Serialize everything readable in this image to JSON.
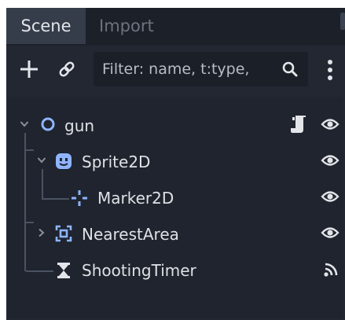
{
  "tabs": [
    {
      "label": "Scene",
      "active": true
    },
    {
      "label": "Import",
      "active": false
    }
  ],
  "toolbar": {
    "add_icon": "plus-icon",
    "link_icon": "link-icon",
    "filter_placeholder": "Filter: name, t:type,",
    "search_icon": "magnifier-icon",
    "menu_icon": "kebab-menu-icon"
  },
  "tree": {
    "nodes": [
      {
        "name": "gun",
        "type": "Node2D",
        "icon": "circle-node-icon",
        "expanded": true,
        "has_script": true,
        "visible": true
      },
      {
        "name": "Sprite2D",
        "type": "Sprite2D",
        "icon": "sprite-face-icon",
        "expanded": true,
        "visible": true
      },
      {
        "name": "Marker2D",
        "type": "Marker2D",
        "icon": "crosshair-marker-icon",
        "visible": true
      },
      {
        "name": "NearestArea",
        "type": "Area2D",
        "icon": "area-frame-icon",
        "expanded": false,
        "visible": true
      },
      {
        "name": "ShootingTimer",
        "type": "Timer",
        "icon": "hourglass-icon",
        "signal": true
      }
    ]
  },
  "colors": {
    "panel_bg": "#222732",
    "tab_active_bg": "#363d4a",
    "tree_bg": "#1f242e",
    "node2d_blue": "#8fb4ff",
    "text": "#dfe1e6"
  }
}
